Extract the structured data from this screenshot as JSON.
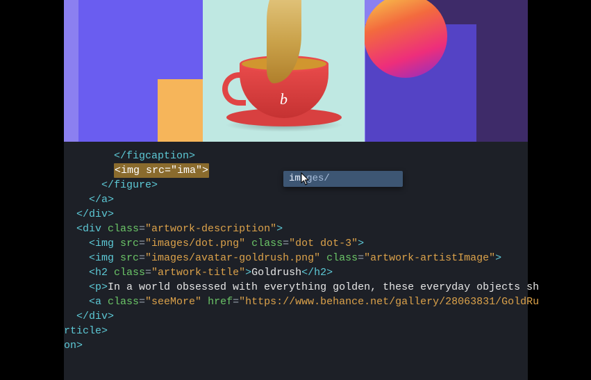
{
  "preview": {
    "cup_logo_glyph": "b"
  },
  "code": {
    "l1": "        </figcaption>",
    "l2_a": "        ",
    "l2_hl": "<img src=\"ima\">",
    "l3": "      </figure>",
    "l4": "    </a>",
    "l5": "  </div>",
    "l6_a": "  <div ",
    "l6_b": "class",
    "l6_c": "=",
    "l6_d": "\"artwork-description\"",
    "l6_e": ">",
    "l7_a": "    <img ",
    "l7_b": "src",
    "l7_c": "=",
    "l7_d": "\"images/dot.png\"",
    "l7_e": " ",
    "l7_f": "class",
    "l7_g": "=",
    "l7_h": "\"dot dot-3\"",
    "l7_i": ">",
    "l8_a": "    <img ",
    "l8_b": "src",
    "l8_c": "=",
    "l8_d": "\"images/avatar-goldrush.png\"",
    "l8_e": " ",
    "l8_f": "class",
    "l8_g": "=",
    "l8_h": "\"artwork-artistImage\"",
    "l8_i": ">",
    "l9_a": "    <h2 ",
    "l9_b": "class",
    "l9_c": "=",
    "l9_d": "\"artwork-title\"",
    "l9_e": ">",
    "l9_f": "Goldrush",
    "l9_g": "</h2>",
    "l10_a": "    <p>",
    "l10_b": "In a world obsessed with everything golden, these everyday objects sh",
    "l11_a": "    <a ",
    "l11_b": "class",
    "l11_c": "=",
    "l11_d": "\"seeMore\"",
    "l11_e": " ",
    "l11_f": "href",
    "l11_g": "=",
    "l11_h": "\"https://www.behance.net/gallery/28063831/GoldRu",
    "l12": "  </div>",
    "l13": "rticle>",
    "l14": "",
    "l15": "on>"
  },
  "autocomplete": {
    "prefix": "im",
    "suffix": "ages/"
  }
}
